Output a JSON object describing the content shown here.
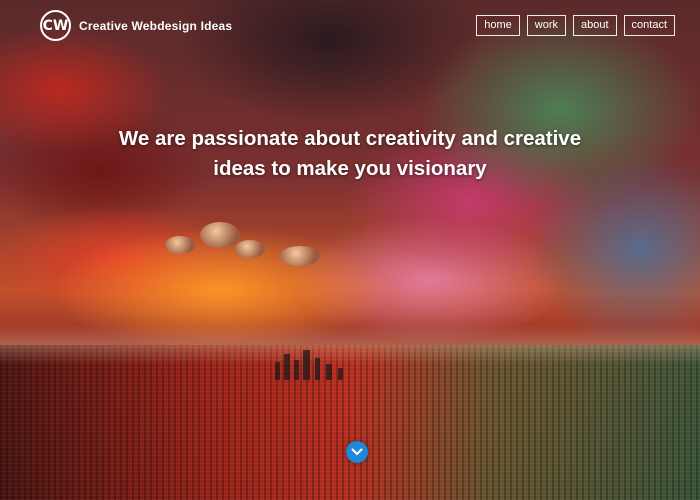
{
  "header": {
    "logo_mark": "CW",
    "logo_text": "Creative Webdesign Ideas",
    "nav": [
      {
        "label": "home"
      },
      {
        "label": "work"
      },
      {
        "label": "about"
      },
      {
        "label": "contact"
      }
    ]
  },
  "hero": {
    "headline_line1": "We are passionate about creativity and creative",
    "headline_line2": "ideas to make you visionary"
  },
  "scroll_button": {
    "icon": "chevron-down-icon",
    "color": "#1f88d8"
  },
  "colors": {
    "nav_border": "#ffffff",
    "text": "#ffffff"
  }
}
